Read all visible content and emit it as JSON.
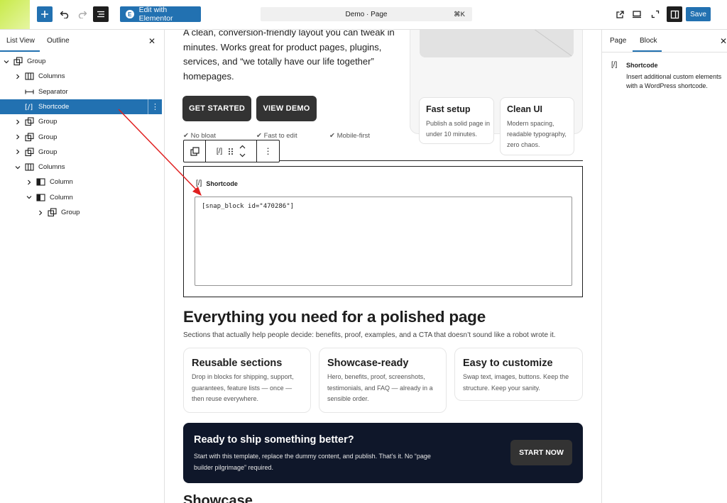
{
  "toolbar": {
    "inserter_icon": "plus-icon",
    "undo_icon": "undo-icon",
    "redo_icon": "redo-icon",
    "document_overview_icon": "list-view-icon",
    "elementor_label": "Edit with Elementor",
    "elementor_logo": "E",
    "command_title": "Demo · Page",
    "command_shortcut": "⌘K",
    "save_label": "Save",
    "accent_color": "#2271b1"
  },
  "list_view": {
    "tabs": [
      "List View",
      "Outline"
    ],
    "close": "✕",
    "items": [
      {
        "label": "Group",
        "icon": "group-icon",
        "depth": 0,
        "expanded": true
      },
      {
        "label": "Columns",
        "icon": "columns-icon",
        "depth": 1,
        "expanded": false
      },
      {
        "label": "Separator",
        "icon": "separator-icon",
        "depth": 1,
        "expanded": null
      },
      {
        "label": "Shortcode",
        "icon": "shortcode-icon",
        "depth": 1,
        "expanded": null,
        "selected": true
      },
      {
        "label": "Group",
        "icon": "group-icon",
        "depth": 1,
        "expanded": false
      },
      {
        "label": "Group",
        "icon": "group-icon",
        "depth": 1,
        "expanded": false
      },
      {
        "label": "Group",
        "icon": "group-icon",
        "depth": 1,
        "expanded": false
      },
      {
        "label": "Columns",
        "icon": "columns-icon",
        "depth": 1,
        "expanded": true
      },
      {
        "label": "Column",
        "icon": "column-icon",
        "depth": 2,
        "expanded": false
      },
      {
        "label": "Column",
        "icon": "column-icon",
        "depth": 2,
        "expanded": true
      },
      {
        "label": "Group",
        "icon": "group-icon",
        "depth": 3,
        "expanded": false
      }
    ]
  },
  "canvas": {
    "hero_text": "A clean, conversion-friendly layout you can tweak in minutes. Works great for product pages, plugins, services, and “we totally have our life together” homepages.",
    "buttons": {
      "get_started": "GET STARTED",
      "view_demo": "VIEW DEMO"
    },
    "checks": [
      "✔ No bloat",
      "✔ Fast to edit",
      "✔ Mobile-first"
    ],
    "feature_cards": [
      {
        "title": "Fast setup",
        "text": "Publish a solid page in under 10 minutes."
      },
      {
        "title": "Clean UI",
        "text": "Modern spacing, readable typography, zero chaos."
      }
    ],
    "block_toolbar": {
      "parent_icon": "group-icon",
      "block_icon": "[/]",
      "drag_icon": "drag-handle-icon",
      "move_icon": "move-up-down-icon",
      "more_icon": "⋮"
    },
    "shortcode_block": {
      "label": "Shortcode",
      "icon": "[/]",
      "value": "[snap_block id=\"470286\"]"
    },
    "section_title": "Everything you need for a polished page",
    "section_subtitle": "Sections that actually help people decide: benefits, proof, examples, and a CTA that doesn’t sound like a robot wrote it.",
    "cards": [
      {
        "title": "Reusable sections",
        "text": "Drop in blocks for shipping, support, guarantees, feature lists — once — then reuse everywhere."
      },
      {
        "title": "Showcase-ready",
        "text": "Hero, benefits, proof, screenshots, testimonials, and FAQ — already in a sensible order."
      },
      {
        "title": "Easy to customize",
        "text": "Swap text, images, buttons. Keep the structure. Keep your sanity."
      }
    ],
    "cta": {
      "title": "Ready to ship something better?",
      "text": "Start with this template, replace the dummy content, and publish. That’s it. No “page builder pilgrimage” required.",
      "button": "START NOW",
      "bg_color": "#0f172a"
    },
    "next_heading": "Showcase"
  },
  "settings": {
    "tabs": [
      "Page",
      "Block"
    ],
    "close": "✕",
    "block_icon": "[/]",
    "block_title": "Shortcode",
    "block_description": "Insert additional custom elements with a WordPress shortcode."
  },
  "annotation": {
    "color": "#e02020"
  }
}
